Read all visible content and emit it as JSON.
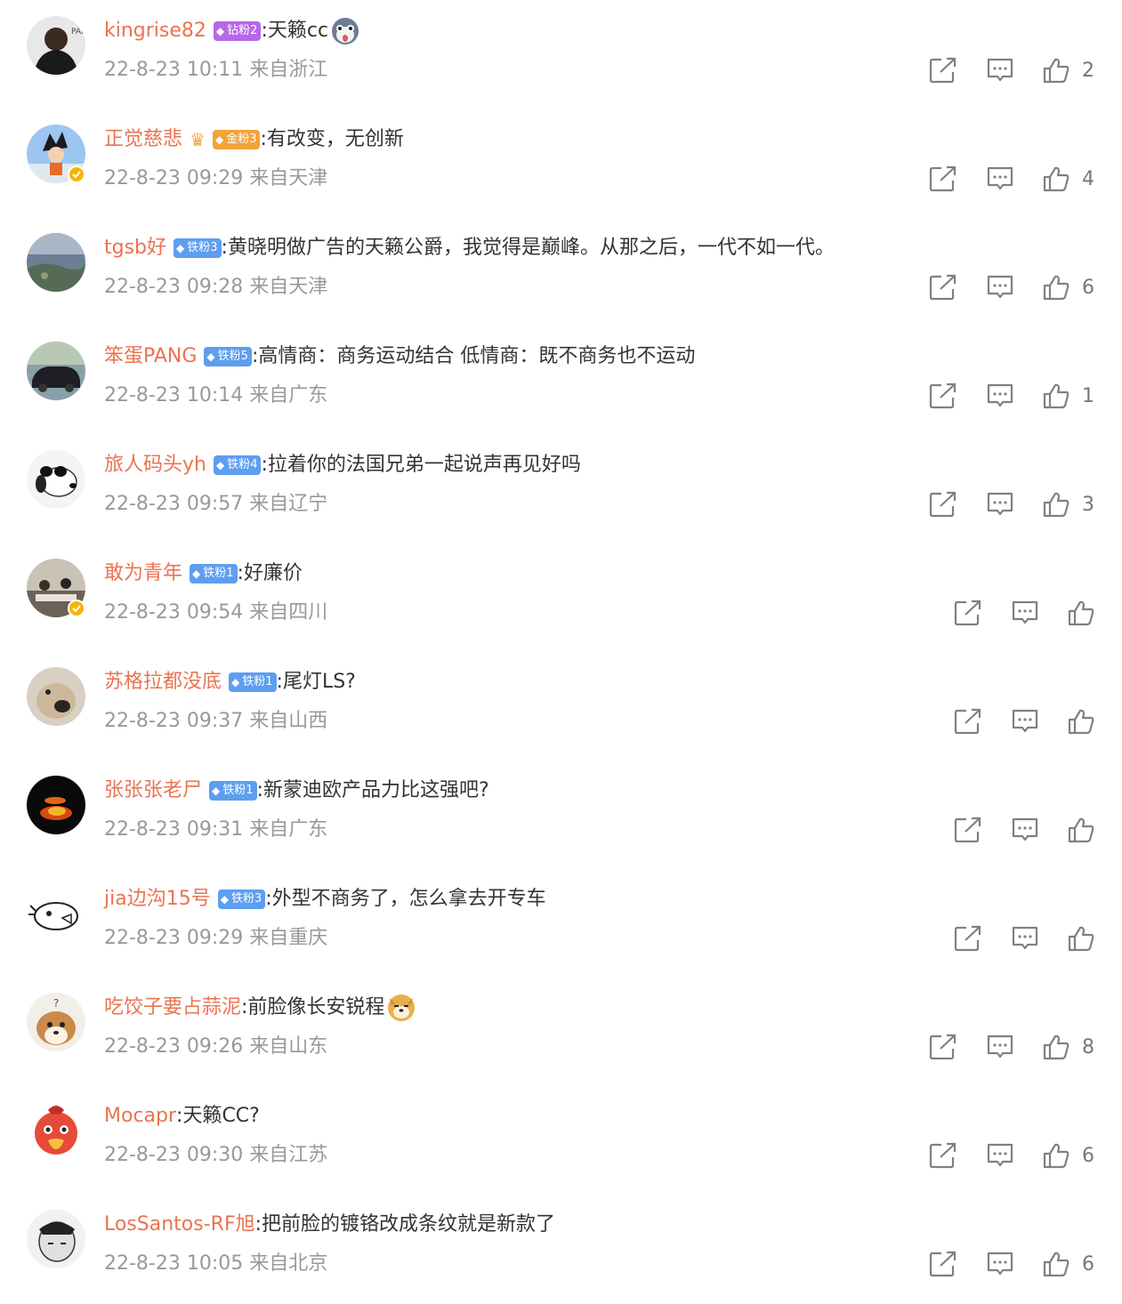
{
  "comments": [
    {
      "user": "kingrise82",
      "badge": {
        "type": "diamond",
        "label": "钻粉2"
      },
      "text": ":天籁cc",
      "emoji": "husky",
      "time": "22-8-23 10:11",
      "location": "来自浙江",
      "likes": "2",
      "verified": false,
      "avatar": "dark"
    },
    {
      "user": "正觉慈悲",
      "badge": {
        "type": "gold",
        "label": "金粉3"
      },
      "text": ":有改变，无创新",
      "emoji": "",
      "time": "22-8-23 09:29",
      "location": "来自天津",
      "likes": "4",
      "verified": true,
      "avatar": "anime"
    },
    {
      "user": "tgsb好",
      "badge": {
        "type": "iron",
        "label": "铁粉3"
      },
      "text": ":黄晓明做广告的天籁公爵，我觉得是巅峰。从那之后，一代不如一代。",
      "emoji": "",
      "time": "22-8-23 09:28",
      "location": "来自天津",
      "likes": "6",
      "verified": false,
      "avatar": "earth"
    },
    {
      "user": "笨蛋PANG",
      "badge": {
        "type": "iron",
        "label": "铁粉5"
      },
      "text": ":高情商：商务运动结合 低情商：既不商务也不运动",
      "emoji": "",
      "time": "22-8-23 10:14",
      "location": "来自广东",
      "likes": "1",
      "verified": false,
      "avatar": "car"
    },
    {
      "user": "旅人码头yh",
      "badge": {
        "type": "iron",
        "label": "铁粉4"
      },
      "text": ":拉着你的法国兄弟一起说声再见好吗",
      "emoji": "",
      "time": "22-8-23 09:57",
      "location": "来自辽宁",
      "likes": "3",
      "verified": false,
      "avatar": "snoopy"
    },
    {
      "user": "敢为青年",
      "badge": {
        "type": "iron",
        "label": "铁粉1"
      },
      "text": ":好廉价",
      "emoji": "",
      "time": "22-8-23 09:54",
      "location": "来自四川",
      "likes": "",
      "verified": true,
      "avatar": "office"
    },
    {
      "user": "苏格拉都没底",
      "badge": {
        "type": "iron",
        "label": "铁粉1"
      },
      "text": ":尾灯LS?",
      "emoji": "",
      "time": "22-8-23 09:37",
      "location": "来自山西",
      "likes": "",
      "verified": false,
      "avatar": "dog"
    },
    {
      "user": "张张张老尸",
      "badge": {
        "type": "iron",
        "label": "铁粉1"
      },
      "text": ":新蒙迪欧产品力比这强吧?",
      "emoji": "",
      "time": "22-8-23 09:31",
      "location": "来自广东",
      "likes": "",
      "verified": false,
      "avatar": "fire"
    },
    {
      "user": "jia边沟15号",
      "badge": {
        "type": "iron",
        "label": "铁粉3"
      },
      "text": ":外型不商务了，怎么拿去开专车",
      "emoji": "",
      "time": "22-8-23 09:29",
      "location": "来自重庆",
      "likes": "",
      "verified": false,
      "avatar": "bird"
    },
    {
      "user": "吃饺子要占蒜泥",
      "badge": null,
      "text": ":前脸像长安锐程",
      "emoji": "doge",
      "time": "22-8-23 09:26",
      "location": "来自山东",
      "likes": "8",
      "verified": false,
      "avatar": "shiba"
    },
    {
      "user": "Mocapr",
      "badge": null,
      "text": ":天籁CC?",
      "emoji": "",
      "time": "22-8-23 09:30",
      "location": "来自江苏",
      "likes": "6",
      "verified": false,
      "avatar": "chicken"
    },
    {
      "user": "LosSantos-RF旭",
      "badge": null,
      "text": ":把前脸的镀铬改成条纹就是新款了",
      "emoji": "",
      "time": "22-8-23 10:05",
      "location": "来自北京",
      "likes": "6",
      "verified": false,
      "avatar": "sketch"
    }
  ],
  "icons": {
    "share": "share-icon",
    "reply": "comment-icon",
    "like": "thumbs-up-icon"
  },
  "colors": {
    "username": "#eb7350",
    "meta": "#999999",
    "iron_badge": "#5e9ef0",
    "diamond_badge": "#b768e6",
    "gold_badge": "#f2a43a",
    "verified": "#f7b500"
  }
}
